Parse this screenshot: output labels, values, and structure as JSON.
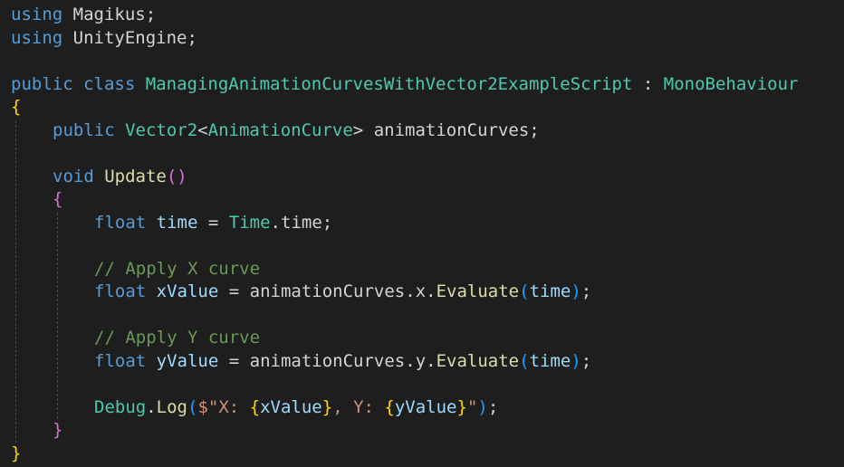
{
  "code": {
    "l1": {
      "kw": "using",
      "ns": "Magikus",
      "end": ";"
    },
    "l2": {
      "kw": "using",
      "ns": "UnityEngine",
      "end": ";"
    },
    "l4": {
      "mod": "public",
      "cls_kw": "class",
      "name": "ManagingAnimationCurvesWithVector2ExampleScript",
      "colon": ":",
      "base": "MonoBehaviour"
    },
    "l5": {
      "brace": "{"
    },
    "l6": {
      "mod": "public",
      "type": "Vector2",
      "lt": "<",
      "arg": "AnimationCurve",
      "gt": ">",
      "field": "animationCurves",
      "end": ";"
    },
    "l8": {
      "kw": "void",
      "method": "Update",
      "parens": "()"
    },
    "l9": {
      "brace": "{"
    },
    "l10": {
      "kw": "float",
      "var": "time",
      "eq": "=",
      "cls": "Time",
      "dot": ".",
      "prop": "time",
      "end": ";"
    },
    "l12": {
      "comment": "// Apply X curve"
    },
    "l13": {
      "kw": "float",
      "var": "xValue",
      "eq": "=",
      "obj": "animationCurves",
      "dot1": ".",
      "prop": "x",
      "dot2": ".",
      "method": "Evaluate",
      "open": "(",
      "arg": "time",
      "close": ")",
      "end": ";"
    },
    "l15": {
      "comment": "// Apply Y curve"
    },
    "l16": {
      "kw": "float",
      "var": "yValue",
      "eq": "=",
      "obj": "animationCurves",
      "dot1": ".",
      "prop": "y",
      "dot2": ".",
      "method": "Evaluate",
      "open": "(",
      "arg": "time",
      "close": ")",
      "end": ";"
    },
    "l18": {
      "cls": "Debug",
      "dot": ".",
      "method": "Log",
      "open": "(",
      "str1": "$\"X: ",
      "lb1": "{",
      "v1": "xValue",
      "rb1": "}",
      "str2": ", Y: ",
      "lb2": "{",
      "v2": "yValue",
      "rb2": "}",
      "str3": "\"",
      "close": ")",
      "end": ";"
    },
    "l19": {
      "brace": "}"
    },
    "l20": {
      "brace": "}"
    }
  }
}
